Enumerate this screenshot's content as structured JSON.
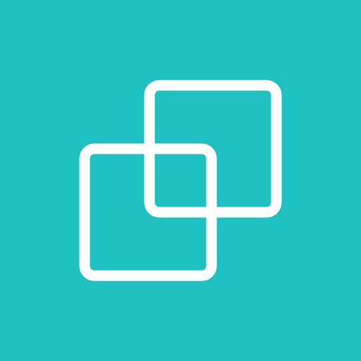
{
  "icon": {
    "name": "overlapping-squares-icon",
    "background_color": "#1ec0c1",
    "stroke_color": "#ffffff"
  }
}
